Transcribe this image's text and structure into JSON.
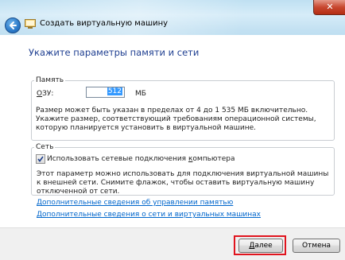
{
  "window": {
    "title": "Создать виртуальную машину",
    "close_glyph": "✕"
  },
  "page": {
    "heading": "Укажите параметры памяти и сети"
  },
  "memory": {
    "group_label": "Память",
    "ram_label_accel": "О",
    "ram_label_rest": "ЗУ:",
    "ram_value": "512",
    "unit": "МБ",
    "description": "Размер может быть указан в пределах от 4 до 1 535 МБ включительно. Укажите размер, соответствующий требованиям операционной системы, которую планируется установить в виртуальной машине."
  },
  "network": {
    "group_label": "Сеть",
    "checkbox_checked": true,
    "checkbox_label_before": "Использовать сетевые подключения ",
    "checkbox_label_accel": "к",
    "checkbox_label_after": "омпьютера",
    "description": "Этот параметр можно использовать для подключения виртуальной машины к внешней сети. Снимите флажок, чтобы оставить виртуальную машину отключенной от сети."
  },
  "links": {
    "memory_info": "Дополнительные сведения об управлении памятью",
    "network_info": "Дополнительные сведения о сети и виртуальных машинах"
  },
  "buttons": {
    "next_accel": "Д",
    "next_rest": "алее",
    "cancel": "Отмена"
  },
  "colors": {
    "heading": "#1f3f91",
    "link": "#0066cc",
    "highlight": "#e0141e",
    "close": "#c8472f"
  }
}
